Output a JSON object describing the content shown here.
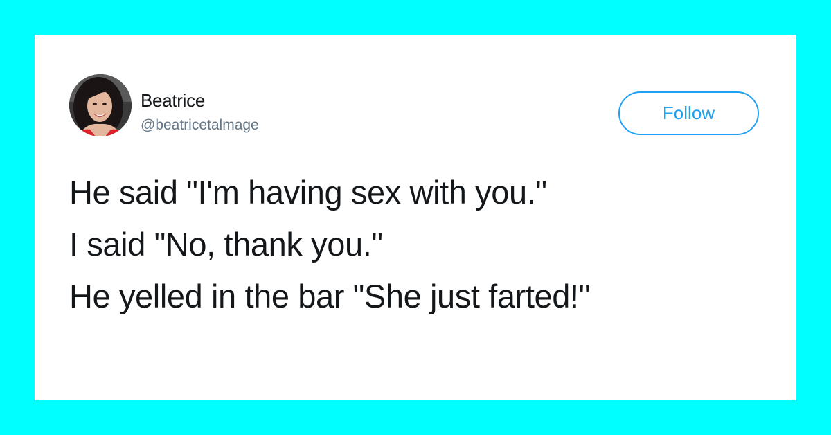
{
  "background_color": "#00FFFF",
  "card_color": "#FFFFFF",
  "accent_color": "#1DA1F2",
  "tweet": {
    "author": {
      "name": "Beatrice",
      "handle": "@beatricetalmage",
      "avatar_icon": "profile-photo"
    },
    "follow_label": "Follow",
    "lines": [
      "He said \"I'm having sex with you.\"",
      "I said \"No, thank you.\"",
      "He yelled in the bar \"She just farted!\""
    ]
  }
}
